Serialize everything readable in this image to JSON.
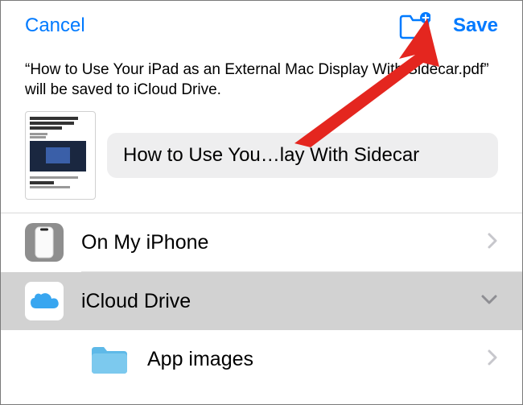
{
  "header": {
    "cancel": "Cancel",
    "save": "Save"
  },
  "prompt": "“How to Use Your iPad as an External Mac Display With Sidecar.pdf” will be saved to iCloud Drive.",
  "filename": "How to Use You…lay With Sidecar",
  "locations": {
    "iphone": "On My iPhone",
    "icloud": "iCloud Drive",
    "app_images": "App images"
  }
}
